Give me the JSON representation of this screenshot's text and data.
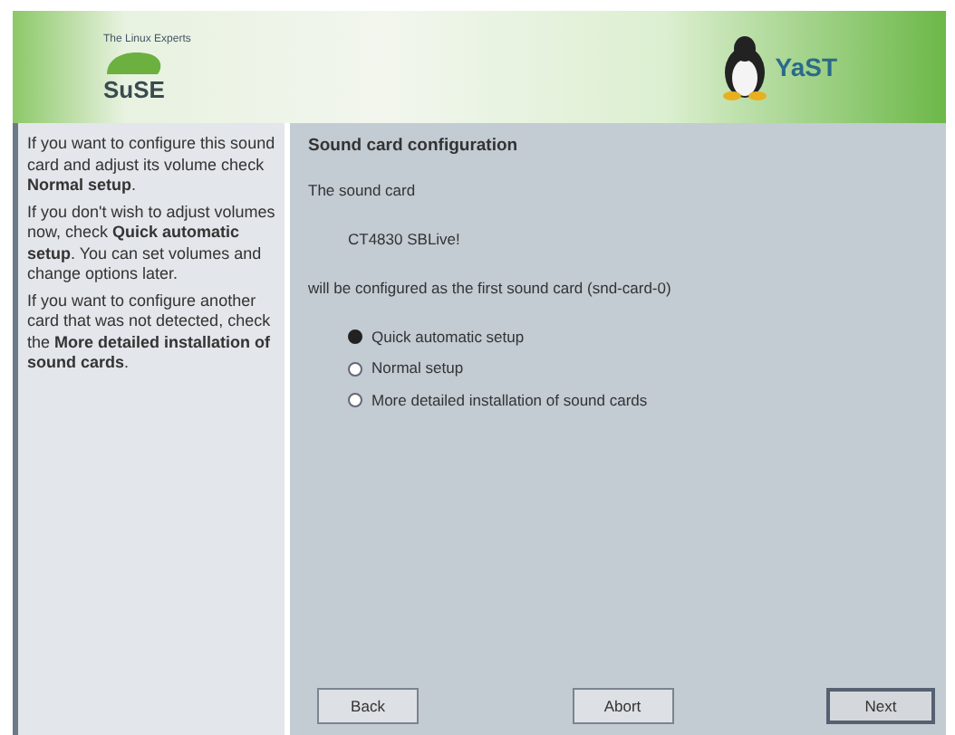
{
  "header": {
    "tagline": "The Linux Experts",
    "logo_text": "SuSE",
    "product": "YaST"
  },
  "help": [
    "If you want to configure this sound card and adjust its volume check **Normal setup**.",
    "If you don't wish to adjust volumes now, check **Quick automatic setup**. You can set volumes and change options later.",
    "If you want to configure another card that was not detected, check the **More detailed installation of sound cards**."
  ],
  "title": "Sound card configuration",
  "intro": "The sound card",
  "card": "CT4830 SBLive!",
  "outro": "will be configured as the first sound card (snd-card-0)",
  "options": [
    {
      "label": "Quick automatic setup",
      "selected": true
    },
    {
      "label": "Normal setup",
      "selected": false
    },
    {
      "label": "More detailed installation of sound cards",
      "selected": false
    }
  ],
  "buttons": [
    {
      "label": "Back",
      "default": false
    },
    {
      "label": "Abort",
      "default": false
    },
    {
      "label": "Next",
      "default": true
    }
  ]
}
